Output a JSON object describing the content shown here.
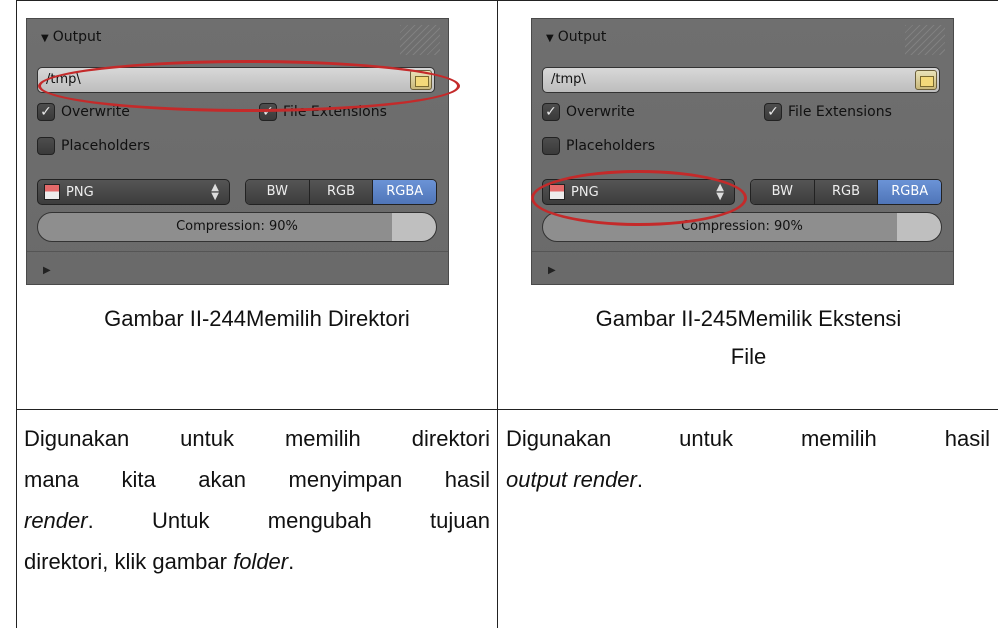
{
  "panels": [
    {
      "header": "Output",
      "path_value": "/tmp\\",
      "checkboxes": [
        "Overwrite",
        "File Extensions",
        "Placeholders"
      ],
      "format": "PNG",
      "color_modes": [
        "BW",
        "RGB",
        "RGBA"
      ],
      "active_color_mode": "RGBA",
      "compression_label": "Compression: 90%",
      "compression": 0.9
    },
    {
      "header": "Output",
      "path_value": "/tmp\\",
      "checkboxes": [
        "Overwrite",
        "File Extensions",
        "Placeholders"
      ],
      "format": "PNG",
      "color_modes": [
        "BW",
        "RGB",
        "RGBA"
      ],
      "active_color_mode": "RGBA",
      "compression_label": "Compression: 90%",
      "compression": 0.9
    }
  ],
  "captions": {
    "left": "Gambar II-244Memilih Direktori",
    "right_line1": "Gambar II-245Memilik Ekstensi",
    "right_line2": "File"
  },
  "descriptions": {
    "left": {
      "line1": "Digunakan untuk memilih direktori",
      "line2": "mana kita akan menyimpan hasil",
      "line3_em": "render",
      "line3_rest": ". Untuk mengubah tujuan",
      "line4_start": "direktori, klik gambar ",
      "line4_em": "folder",
      "line4_end": "."
    },
    "right": {
      "line1": "Digunakan untuk memilih hasil",
      "line2_em": "output render",
      "line2_end": "."
    }
  },
  "colors": {
    "highlight": "#c42a2a",
    "active_mode": "#5a80c4"
  }
}
